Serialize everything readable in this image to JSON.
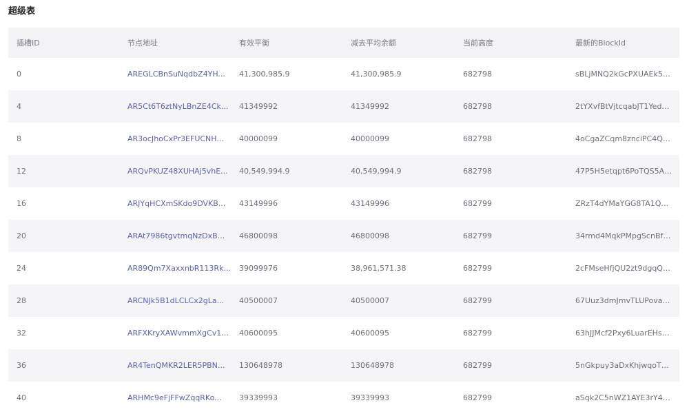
{
  "page": {
    "title": "超级表"
  },
  "table": {
    "columns": [
      "插槽ID",
      "节点地址",
      "有效平衡",
      "减去平均余额",
      "当前高度",
      "最新的BlockId"
    ],
    "rows": [
      [
        "0",
        "AREGLCBnSuNqdbZ4YH...",
        "41,300,985.9",
        "41,300,985.9",
        "682798",
        "sBLjMNQ2kGcPXUAEk5Y···"
      ],
      [
        "4",
        "AR5Ct6T6ztNyLBnZE4Ck...",
        "41349992",
        "41349992",
        "682798",
        "2tYXvfBtVjtcqabJT1YedBt···"
      ],
      [
        "8",
        "AR3ocJhoCxPr3EFUCNH...",
        "40000099",
        "40000099",
        "682798",
        "4oCgaZCqm8znciPC4Q8···"
      ],
      [
        "12",
        "ARQvPKUZ48XUHAj5vhE...",
        "40,549,994.9",
        "40,549,994.9",
        "682798",
        "47P5H5etqpt6PoTQS5Ak···"
      ],
      [
        "16",
        "ARJYqHCXmSKdo9DVKB...",
        "43149996",
        "43149996",
        "682799",
        "ZRzT4dYMaYGG8TA1Qa···"
      ],
      [
        "20",
        "ARAt7986tgvtmqNzDxB...",
        "46800098",
        "46800098",
        "682799",
        "34rmd4MqkPMpgScnBf1···"
      ],
      [
        "24",
        "AR89Qm7XaxxnbR113Rk...",
        "39099976",
        "38,961,571.38",
        "682799",
        "2cFMseHfjQU2zt9dgqQiJ···"
      ],
      [
        "28",
        "ARCNJk5B1dLCLCx2gLa...",
        "40500007",
        "40500007",
        "682799",
        "67Uuz3dmJmvTLUPova5···"
      ],
      [
        "32",
        "ARFXKryXAWvmmXgCv1...",
        "40600095",
        "40600095",
        "682799",
        "63hJJMcf2Pxy6LuarEHsxF···"
      ],
      [
        "36",
        "AR4TenQMKR2LER5PBN...",
        "130648978",
        "130648978",
        "682799",
        "5nGkpuy3aDxKhjwqoT3x···"
      ],
      [
        "40",
        "ARHMc9eFjFFwZqqRKo...",
        "39339993",
        "39339993",
        "682799",
        "aSqk2C5nWZ1AYE3rY4u···"
      ]
    ]
  }
}
